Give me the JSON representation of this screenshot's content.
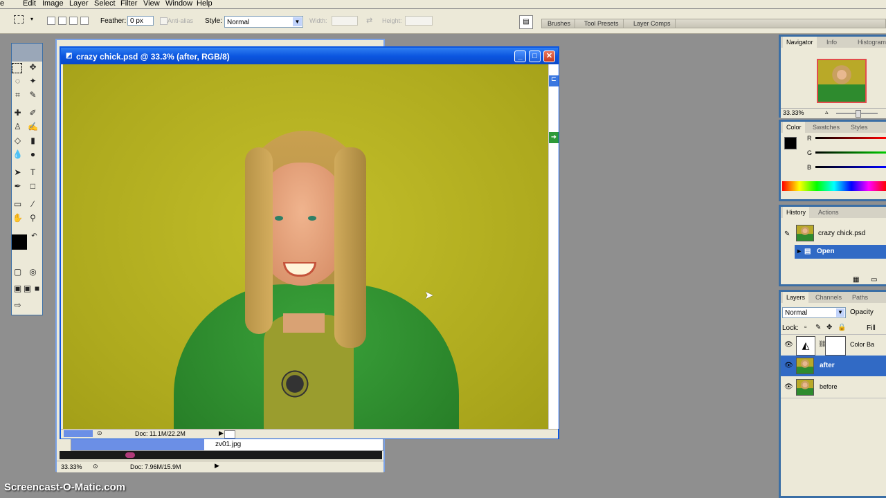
{
  "menu": [
    "e",
    "Edit",
    "Image",
    "Layer",
    "Select",
    "Filter",
    "View",
    "Window",
    "Help"
  ],
  "options": {
    "feather_label": "Feather:",
    "feather_value": "0 px",
    "antialias_label": "Anti-alias",
    "style_label": "Style:",
    "style_value": "Normal",
    "width_label": "Width:",
    "height_label": "Height:"
  },
  "wells": [
    "Brushes",
    "Tool Presets",
    "Layer Comps"
  ],
  "doc_back": {
    "tab_label": "zv01.jpg",
    "zoom": "33.33%",
    "doc_size": "Doc: 7.96M/15.9M"
  },
  "doc_main": {
    "title": "crazy chick.psd @ 33.3% (after, RGB/8)",
    "doc_size": "Doc: 11.1M/22.2M"
  },
  "navigator": {
    "tabs": [
      "Navigator",
      "Info",
      "Histogram"
    ],
    "zoom": "33.33%"
  },
  "color": {
    "tabs": [
      "Color",
      "Swatches",
      "Styles"
    ],
    "channels": [
      "R",
      "G",
      "B"
    ]
  },
  "history": {
    "tabs": [
      "History",
      "Actions"
    ],
    "snapshot": "crazy chick.psd",
    "items": [
      "Open"
    ]
  },
  "layers": {
    "tabs": [
      "Layers",
      "Channels",
      "Paths"
    ],
    "blend": "Normal",
    "opacity_label": "Opacity",
    "lock_label": "Lock:",
    "fill_label": "Fill",
    "list": [
      "Color Ba",
      "after",
      "before"
    ]
  },
  "watermark": "Screencast-O-Matic.com",
  "colors": {
    "canvas_bg": "#b8b424",
    "hoodie": "#2f8c2f",
    "selection": "#316ac5",
    "titlebar": "#0b56e0"
  }
}
